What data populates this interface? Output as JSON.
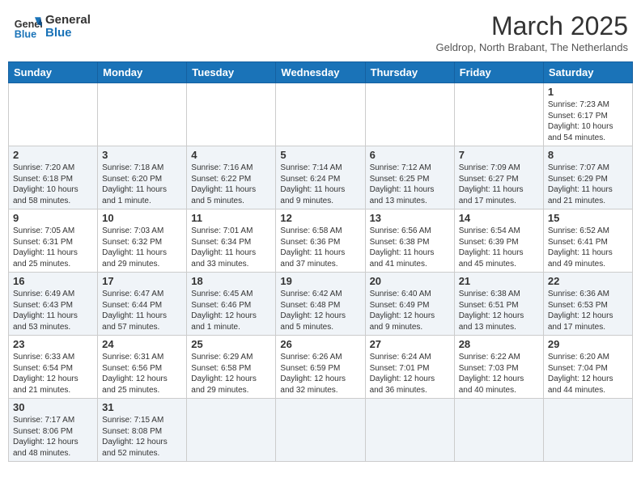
{
  "header": {
    "logo_general": "General",
    "logo_blue": "Blue",
    "title": "March 2025",
    "location": "Geldrop, North Brabant, The Netherlands"
  },
  "days_of_week": [
    "Sunday",
    "Monday",
    "Tuesday",
    "Wednesday",
    "Thursday",
    "Friday",
    "Saturday"
  ],
  "weeks": [
    [
      {
        "day": "",
        "info": ""
      },
      {
        "day": "",
        "info": ""
      },
      {
        "day": "",
        "info": ""
      },
      {
        "day": "",
        "info": ""
      },
      {
        "day": "",
        "info": ""
      },
      {
        "day": "",
        "info": ""
      },
      {
        "day": "1",
        "info": "Sunrise: 7:23 AM\nSunset: 6:17 PM\nDaylight: 10 hours and 54 minutes."
      }
    ],
    [
      {
        "day": "2",
        "info": "Sunrise: 7:20 AM\nSunset: 6:18 PM\nDaylight: 10 hours and 58 minutes."
      },
      {
        "day": "3",
        "info": "Sunrise: 7:18 AM\nSunset: 6:20 PM\nDaylight: 11 hours and 1 minute."
      },
      {
        "day": "4",
        "info": "Sunrise: 7:16 AM\nSunset: 6:22 PM\nDaylight: 11 hours and 5 minutes."
      },
      {
        "day": "5",
        "info": "Sunrise: 7:14 AM\nSunset: 6:24 PM\nDaylight: 11 hours and 9 minutes."
      },
      {
        "day": "6",
        "info": "Sunrise: 7:12 AM\nSunset: 6:25 PM\nDaylight: 11 hours and 13 minutes."
      },
      {
        "day": "7",
        "info": "Sunrise: 7:09 AM\nSunset: 6:27 PM\nDaylight: 11 hours and 17 minutes."
      },
      {
        "day": "8",
        "info": "Sunrise: 7:07 AM\nSunset: 6:29 PM\nDaylight: 11 hours and 21 minutes."
      }
    ],
    [
      {
        "day": "9",
        "info": "Sunrise: 7:05 AM\nSunset: 6:31 PM\nDaylight: 11 hours and 25 minutes."
      },
      {
        "day": "10",
        "info": "Sunrise: 7:03 AM\nSunset: 6:32 PM\nDaylight: 11 hours and 29 minutes."
      },
      {
        "day": "11",
        "info": "Sunrise: 7:01 AM\nSunset: 6:34 PM\nDaylight: 11 hours and 33 minutes."
      },
      {
        "day": "12",
        "info": "Sunrise: 6:58 AM\nSunset: 6:36 PM\nDaylight: 11 hours and 37 minutes."
      },
      {
        "day": "13",
        "info": "Sunrise: 6:56 AM\nSunset: 6:38 PM\nDaylight: 11 hours and 41 minutes."
      },
      {
        "day": "14",
        "info": "Sunrise: 6:54 AM\nSunset: 6:39 PM\nDaylight: 11 hours and 45 minutes."
      },
      {
        "day": "15",
        "info": "Sunrise: 6:52 AM\nSunset: 6:41 PM\nDaylight: 11 hours and 49 minutes."
      }
    ],
    [
      {
        "day": "16",
        "info": "Sunrise: 6:49 AM\nSunset: 6:43 PM\nDaylight: 11 hours and 53 minutes."
      },
      {
        "day": "17",
        "info": "Sunrise: 6:47 AM\nSunset: 6:44 PM\nDaylight: 11 hours and 57 minutes."
      },
      {
        "day": "18",
        "info": "Sunrise: 6:45 AM\nSunset: 6:46 PM\nDaylight: 12 hours and 1 minute."
      },
      {
        "day": "19",
        "info": "Sunrise: 6:42 AM\nSunset: 6:48 PM\nDaylight: 12 hours and 5 minutes."
      },
      {
        "day": "20",
        "info": "Sunrise: 6:40 AM\nSunset: 6:49 PM\nDaylight: 12 hours and 9 minutes."
      },
      {
        "day": "21",
        "info": "Sunrise: 6:38 AM\nSunset: 6:51 PM\nDaylight: 12 hours and 13 minutes."
      },
      {
        "day": "22",
        "info": "Sunrise: 6:36 AM\nSunset: 6:53 PM\nDaylight: 12 hours and 17 minutes."
      }
    ],
    [
      {
        "day": "23",
        "info": "Sunrise: 6:33 AM\nSunset: 6:54 PM\nDaylight: 12 hours and 21 minutes."
      },
      {
        "day": "24",
        "info": "Sunrise: 6:31 AM\nSunset: 6:56 PM\nDaylight: 12 hours and 25 minutes."
      },
      {
        "day": "25",
        "info": "Sunrise: 6:29 AM\nSunset: 6:58 PM\nDaylight: 12 hours and 29 minutes."
      },
      {
        "day": "26",
        "info": "Sunrise: 6:26 AM\nSunset: 6:59 PM\nDaylight: 12 hours and 32 minutes."
      },
      {
        "day": "27",
        "info": "Sunrise: 6:24 AM\nSunset: 7:01 PM\nDaylight: 12 hours and 36 minutes."
      },
      {
        "day": "28",
        "info": "Sunrise: 6:22 AM\nSunset: 7:03 PM\nDaylight: 12 hours and 40 minutes."
      },
      {
        "day": "29",
        "info": "Sunrise: 6:20 AM\nSunset: 7:04 PM\nDaylight: 12 hours and 44 minutes."
      }
    ],
    [
      {
        "day": "30",
        "info": "Sunrise: 7:17 AM\nSunset: 8:06 PM\nDaylight: 12 hours and 48 minutes."
      },
      {
        "day": "31",
        "info": "Sunrise: 7:15 AM\nSunset: 8:08 PM\nDaylight: 12 hours and 52 minutes."
      },
      {
        "day": "",
        "info": ""
      },
      {
        "day": "",
        "info": ""
      },
      {
        "day": "",
        "info": ""
      },
      {
        "day": "",
        "info": ""
      },
      {
        "day": "",
        "info": ""
      }
    ]
  ]
}
